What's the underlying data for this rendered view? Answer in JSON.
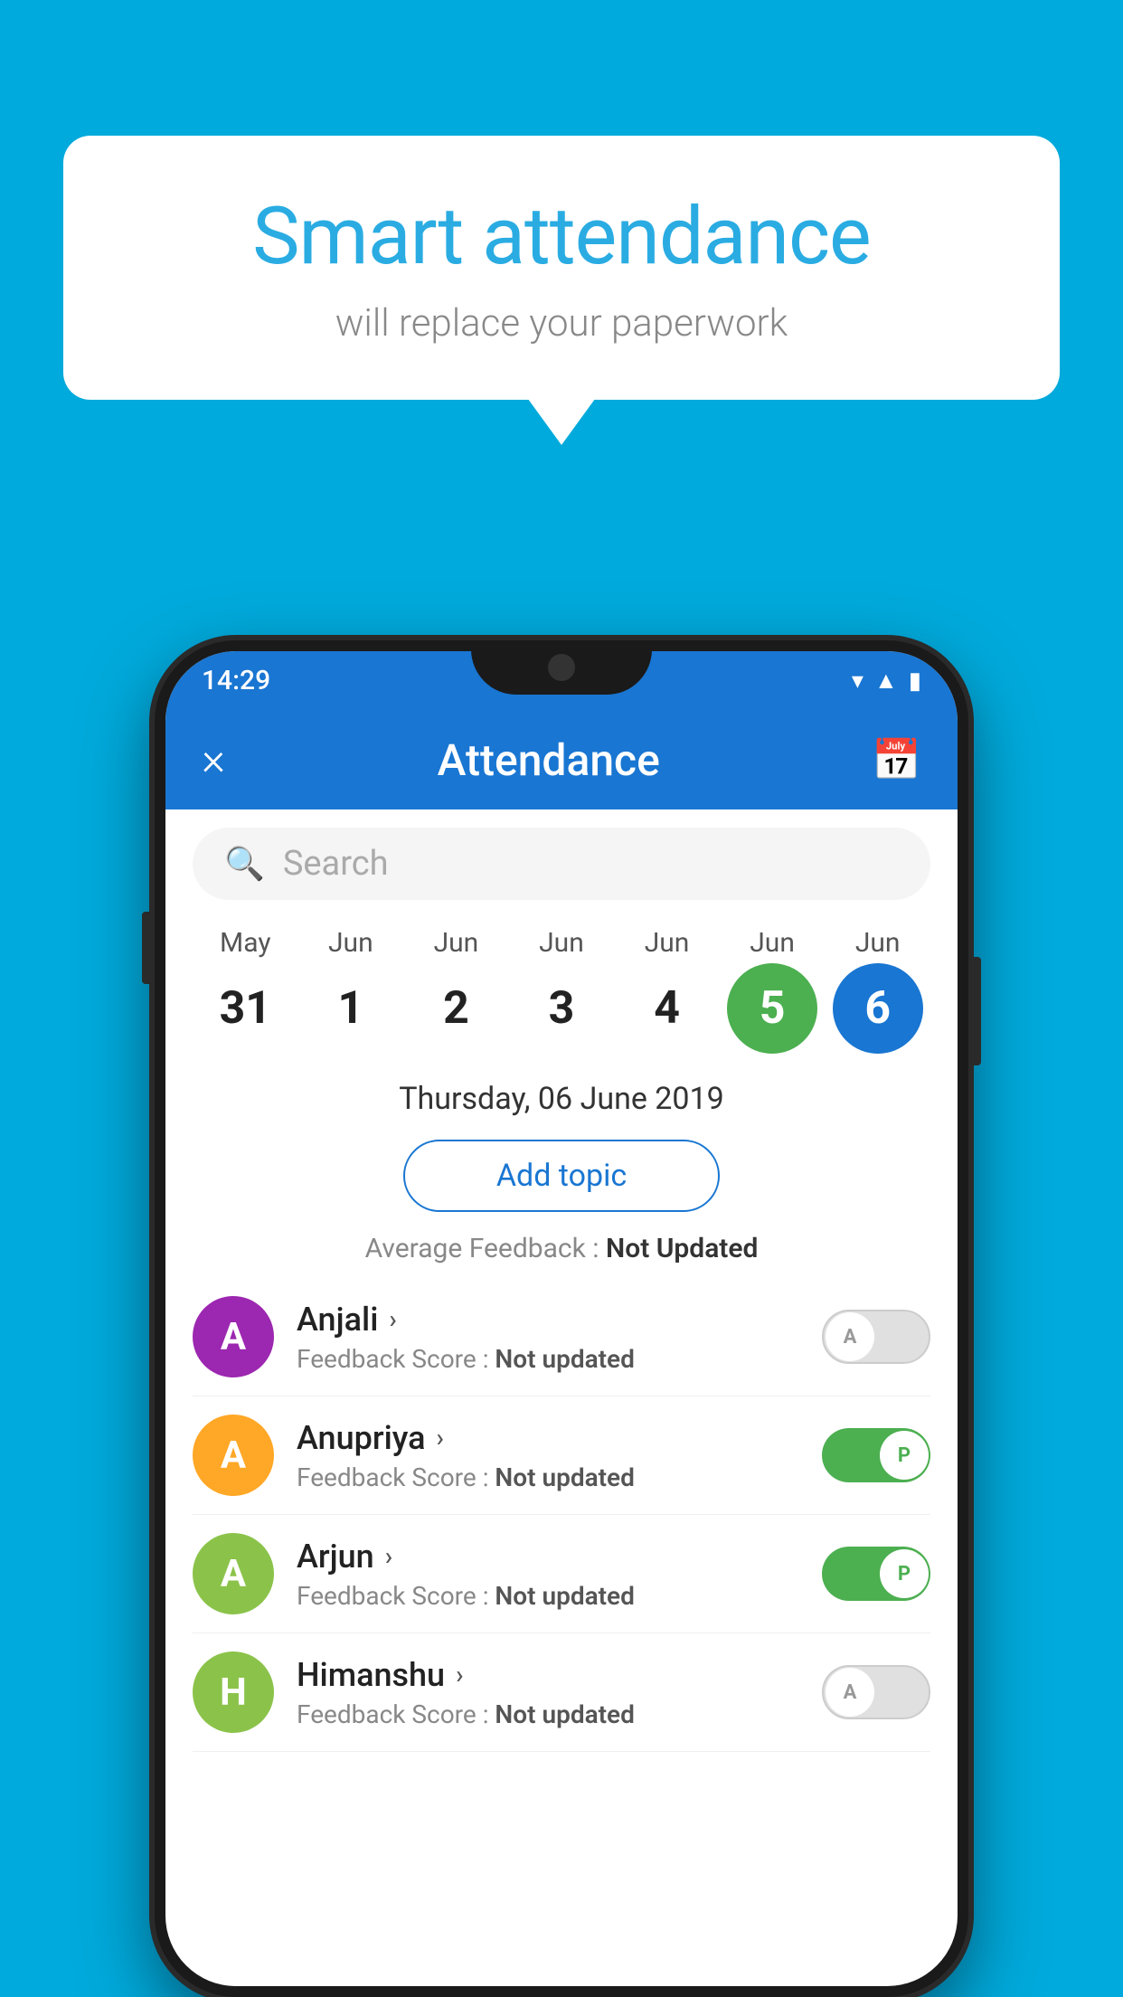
{
  "background_color": "#00AADC",
  "bubble": {
    "title": "Smart attendance",
    "subtitle": "will replace your paperwork"
  },
  "status_bar": {
    "time": "14:29"
  },
  "app_bar": {
    "title": "Attendance",
    "close_label": "×",
    "calendar_icon": "📅"
  },
  "search": {
    "placeholder": "Search"
  },
  "calendar": {
    "months": [
      "May",
      "Jun",
      "Jun",
      "Jun",
      "Jun",
      "Jun",
      "Jun"
    ],
    "dates": [
      "31",
      "1",
      "2",
      "3",
      "4",
      "5",
      "6"
    ],
    "today_index": 5,
    "selected_index": 6
  },
  "selected_date": "Thursday, 06 June 2019",
  "add_topic_label": "Add topic",
  "avg_feedback_label": "Average Feedback : ",
  "avg_feedback_value": "Not Updated",
  "students": [
    {
      "name": "Anjali",
      "initial": "A",
      "avatar_color": "#9C27B0",
      "feedback_label": "Feedback Score : ",
      "feedback_value": "Not updated",
      "toggle_state": "off",
      "toggle_letter": "A"
    },
    {
      "name": "Anupriya",
      "initial": "A",
      "avatar_color": "#FFA726",
      "feedback_label": "Feedback Score : ",
      "feedback_value": "Not updated",
      "toggle_state": "on",
      "toggle_letter": "P"
    },
    {
      "name": "Arjun",
      "initial": "A",
      "avatar_color": "#8BC34A",
      "feedback_label": "Feedback Score : ",
      "feedback_value": "Not updated",
      "toggle_state": "on",
      "toggle_letter": "P"
    },
    {
      "name": "Himanshu",
      "initial": "H",
      "avatar_color": "#8BC34A",
      "feedback_label": "Feedback Score : ",
      "feedback_value": "Not updated",
      "toggle_state": "off",
      "toggle_letter": "A"
    }
  ]
}
